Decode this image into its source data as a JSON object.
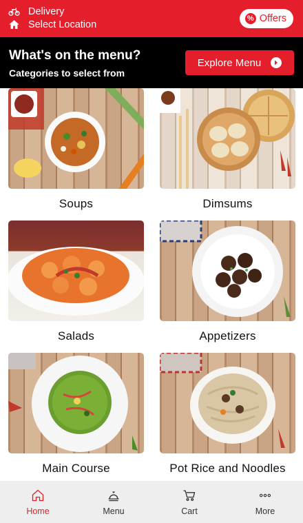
{
  "header": {
    "delivery_label": "Delivery",
    "location_label": "Select Location",
    "offers_label": "Offers",
    "offers_icon": "percent-badge-icon",
    "bg_color": "#e41e2b"
  },
  "banner": {
    "title": "What's on the menu?",
    "subtitle": "Categories to select from",
    "explore_label": "Explore Menu"
  },
  "categories": [
    {
      "label": "Soups"
    },
    {
      "label": "Dimsums"
    },
    {
      "label": "Salads"
    },
    {
      "label": "Appetizers"
    },
    {
      "label": "Main Course"
    },
    {
      "label": "Pot Rice and Noodles"
    }
  ],
  "nav": {
    "items": [
      {
        "label": "Home",
        "icon": "home-icon",
        "active": true
      },
      {
        "label": "Menu",
        "icon": "cloche-icon",
        "active": false
      },
      {
        "label": "Cart",
        "icon": "cart-icon",
        "active": false
      },
      {
        "label": "More",
        "icon": "more-dots-icon",
        "active": false
      }
    ],
    "active_color": "#e41e2b"
  }
}
